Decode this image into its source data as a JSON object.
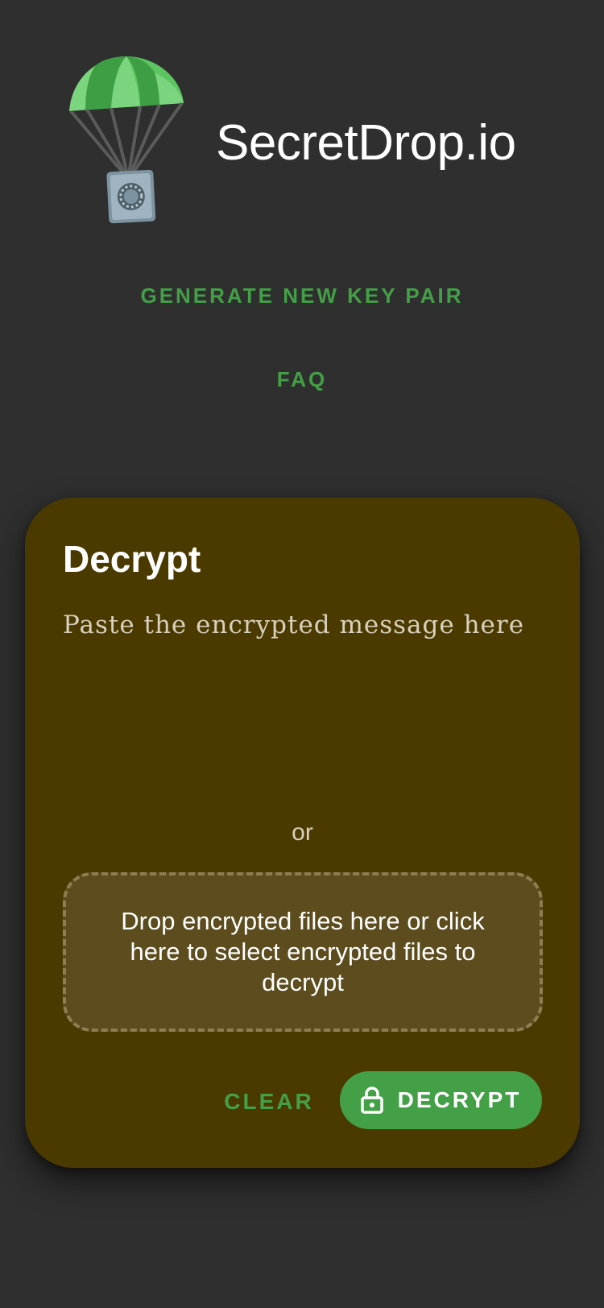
{
  "header": {
    "app_title": "SecretDrop.io",
    "logo_icon": "parachute-safe-logo"
  },
  "nav": {
    "generate_label": "GENERATE NEW KEY PAIR",
    "faq_label": "FAQ"
  },
  "decrypt_card": {
    "title": "Decrypt",
    "message_placeholder": "Paste the encrypted message here",
    "message_value": "",
    "or_text": "or",
    "drop_zone_text": "Drop encrypted files here or click here to select encrypted files to decrypt",
    "clear_label": "CLEAR",
    "decrypt_label": "DECRYPT",
    "decrypt_icon": "lock-icon"
  },
  "colors": {
    "background": "#2f2f2f",
    "accent_green": "#43a047",
    "card_background": "#4b3a00",
    "drop_zone_background": "#5c4c1e"
  }
}
